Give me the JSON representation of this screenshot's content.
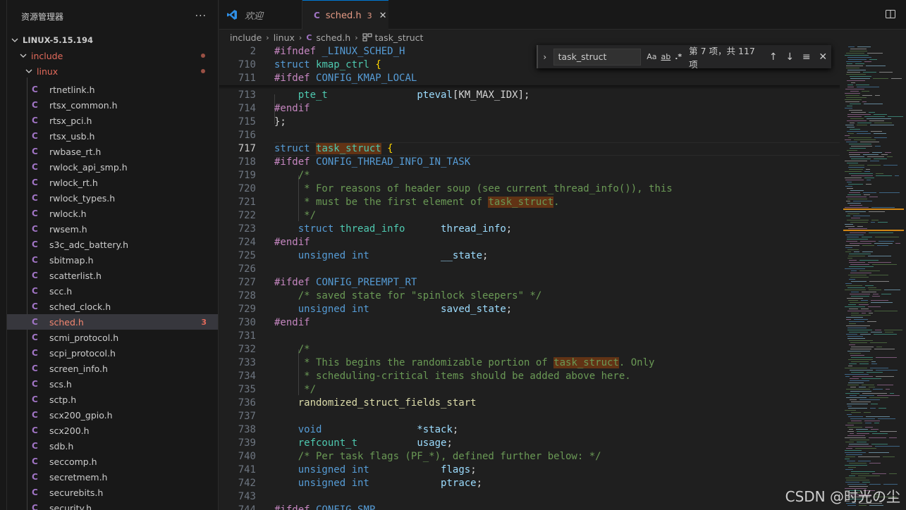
{
  "sidebar": {
    "title": "资源管理器",
    "more": "···",
    "root": "LINUX-5.15.194",
    "folder_include": "include",
    "folder_linux": "linux",
    "files": [
      {
        "name": "rtnetlink.h"
      },
      {
        "name": "rtsx_common.h"
      },
      {
        "name": "rtsx_pci.h"
      },
      {
        "name": "rtsx_usb.h"
      },
      {
        "name": "rwbase_rt.h"
      },
      {
        "name": "rwlock_api_smp.h"
      },
      {
        "name": "rwlock_rt.h"
      },
      {
        "name": "rwlock_types.h"
      },
      {
        "name": "rwlock.h"
      },
      {
        "name": "rwsem.h"
      },
      {
        "name": "s3c_adc_battery.h"
      },
      {
        "name": "sbitmap.h"
      },
      {
        "name": "scatterlist.h"
      },
      {
        "name": "scc.h"
      },
      {
        "name": "sched_clock.h"
      },
      {
        "name": "sched.h",
        "badge": "3",
        "selected": true
      },
      {
        "name": "scmi_protocol.h"
      },
      {
        "name": "scpi_protocol.h"
      },
      {
        "name": "screen_info.h"
      },
      {
        "name": "scs.h"
      },
      {
        "name": "sctp.h"
      },
      {
        "name": "scx200_gpio.h"
      },
      {
        "name": "scx200.h"
      },
      {
        "name": "sdb.h"
      },
      {
        "name": "seccomp.h"
      },
      {
        "name": "secretmem.h"
      },
      {
        "name": "securebits.h"
      },
      {
        "name": "security.h"
      }
    ],
    "file_icon": "C"
  },
  "tabs": {
    "tab1_label": "欢迎",
    "tab2_icon": "C",
    "tab2_label": "sched.h",
    "tab2_count": "3",
    "tab2_close": "✕"
  },
  "breadcrumb": {
    "b1": "include",
    "b2": "linux",
    "b3": "sched.h",
    "b4": "task_struct",
    "sep": "›"
  },
  "find": {
    "toggle": "›",
    "query": "task_struct",
    "opt_case": "Aa",
    "opt_word": "ab",
    "opt_regex": ".*",
    "count": "第 7 项，共 117 项",
    "prev": "↑",
    "next": "↓",
    "selection": "≡",
    "close": "✕"
  },
  "sticky": [
    {
      "n": "2",
      "t": [
        [
          "#ifndef ",
          "k-pre"
        ],
        [
          "_LINUX_SCHED_H",
          "k-mac"
        ]
      ]
    },
    {
      "n": "710",
      "t": [
        [
          "struct ",
          "k-kw"
        ],
        [
          "kmap_ctrl ",
          "k-type"
        ],
        [
          "{",
          "k-brace"
        ]
      ]
    },
    {
      "n": "711",
      "t": [
        [
          "#ifdef ",
          "k-pre"
        ],
        [
          "CONFIG_KMAP_LOCAL",
          "k-mac"
        ]
      ]
    }
  ],
  "code": [
    {
      "n": "713",
      "t": [
        [
          "    ",
          "k-plain"
        ],
        [
          "pte_t",
          "k-type"
        ],
        [
          "               ",
          "k-plain"
        ],
        [
          "pteval",
          "k-var"
        ],
        [
          "[KM_MAX_IDX];",
          "k-plain"
        ]
      ]
    },
    {
      "n": "714",
      "t": [
        [
          "#endif",
          "k-pre"
        ]
      ]
    },
    {
      "n": "715",
      "t": [
        [
          "};",
          "k-plain"
        ]
      ]
    },
    {
      "n": "716",
      "t": []
    },
    {
      "n": "717",
      "cur": true,
      "t": [
        [
          "struct ",
          "k-kw"
        ],
        [
          "task_struct",
          "k-type hl"
        ],
        [
          " ",
          "k-plain"
        ],
        [
          "{",
          "k-brace"
        ]
      ]
    },
    {
      "n": "718",
      "t": [
        [
          "#ifdef ",
          "k-pre"
        ],
        [
          "CONFIG_THREAD_INFO_IN_TASK",
          "k-mac"
        ]
      ]
    },
    {
      "n": "719",
      "t": [
        [
          "    /*",
          "k-com"
        ]
      ]
    },
    {
      "n": "720",
      "t": [
        [
          "     * For reasons of header soup (see current_thread_info()), this",
          "k-com"
        ]
      ]
    },
    {
      "n": "721",
      "t": [
        [
          "     * must be the first element of ",
          "k-com"
        ],
        [
          "task_struct",
          "k-com hl"
        ],
        [
          ".",
          "k-com"
        ]
      ]
    },
    {
      "n": "722",
      "t": [
        [
          "     */",
          "k-com"
        ]
      ]
    },
    {
      "n": "723",
      "t": [
        [
          "    ",
          "k-plain"
        ],
        [
          "struct ",
          "k-kw"
        ],
        [
          "thread_info",
          "k-type"
        ],
        [
          "      ",
          "k-plain"
        ],
        [
          "thread_info",
          "k-var"
        ],
        [
          ";",
          "k-plain"
        ]
      ]
    },
    {
      "n": "724",
      "t": [
        [
          "#endif",
          "k-pre"
        ]
      ]
    },
    {
      "n": "725",
      "t": [
        [
          "    ",
          "k-plain"
        ],
        [
          "unsigned int",
          "k-kw"
        ],
        [
          "            ",
          "k-plain"
        ],
        [
          "__state",
          "k-var"
        ],
        [
          ";",
          "k-plain"
        ]
      ]
    },
    {
      "n": "726",
      "t": []
    },
    {
      "n": "727",
      "t": [
        [
          "#ifdef ",
          "k-pre"
        ],
        [
          "CONFIG_PREEMPT_RT",
          "k-mac"
        ]
      ]
    },
    {
      "n": "728",
      "t": [
        [
          "    /* saved state for \"spinlock sleepers\" */",
          "k-com"
        ]
      ]
    },
    {
      "n": "729",
      "t": [
        [
          "    ",
          "k-plain"
        ],
        [
          "unsigned int",
          "k-kw"
        ],
        [
          "            ",
          "k-plain"
        ],
        [
          "saved_state",
          "k-var"
        ],
        [
          ";",
          "k-plain"
        ]
      ]
    },
    {
      "n": "730",
      "t": [
        [
          "#endif",
          "k-pre"
        ]
      ]
    },
    {
      "n": "731",
      "t": []
    },
    {
      "n": "732",
      "t": [
        [
          "    /*",
          "k-com"
        ]
      ]
    },
    {
      "n": "733",
      "t": [
        [
          "     * This begins the randomizable portion of ",
          "k-com"
        ],
        [
          "task_struct",
          "k-com hl"
        ],
        [
          ". Only",
          "k-com"
        ]
      ]
    },
    {
      "n": "734",
      "t": [
        [
          "     * scheduling-critical items should be added above here.",
          "k-com"
        ]
      ]
    },
    {
      "n": "735",
      "t": [
        [
          "     */",
          "k-com"
        ]
      ]
    },
    {
      "n": "736",
      "t": [
        [
          "    ",
          "k-plain"
        ],
        [
          "randomized_struct_fields_start",
          "k-fn"
        ]
      ]
    },
    {
      "n": "737",
      "t": []
    },
    {
      "n": "738",
      "t": [
        [
          "    ",
          "k-plain"
        ],
        [
          "void",
          "k-kw"
        ],
        [
          "                ",
          "k-plain"
        ],
        [
          "*stack",
          "k-var"
        ],
        [
          ";",
          "k-plain"
        ]
      ]
    },
    {
      "n": "739",
      "t": [
        [
          "    ",
          "k-plain"
        ],
        [
          "refcount_t",
          "k-type"
        ],
        [
          "          ",
          "k-plain"
        ],
        [
          "usage",
          "k-var"
        ],
        [
          ";",
          "k-plain"
        ]
      ]
    },
    {
      "n": "740",
      "t": [
        [
          "    /* Per task flags (PF_*), defined further below: */",
          "k-com"
        ]
      ]
    },
    {
      "n": "741",
      "t": [
        [
          "    ",
          "k-plain"
        ],
        [
          "unsigned int",
          "k-kw"
        ],
        [
          "            ",
          "k-plain"
        ],
        [
          "flags",
          "k-var"
        ],
        [
          ";",
          "k-plain"
        ]
      ]
    },
    {
      "n": "742",
      "t": [
        [
          "    ",
          "k-plain"
        ],
        [
          "unsigned int",
          "k-kw"
        ],
        [
          "            ",
          "k-plain"
        ],
        [
          "ptrace",
          "k-var"
        ],
        [
          ";",
          "k-plain"
        ]
      ]
    },
    {
      "n": "743",
      "t": []
    },
    {
      "n": "744",
      "t": [
        [
          "#ifdef ",
          "k-pre"
        ],
        [
          "CONFIG_SMP",
          "k-mac"
        ]
      ]
    }
  ],
  "watermark": "CSDN @时光の尘",
  "colors": {
    "accent": "#0078d4",
    "highlight": "#623315",
    "folder": "#e36a5b",
    "c_icon": "#a074c4"
  }
}
